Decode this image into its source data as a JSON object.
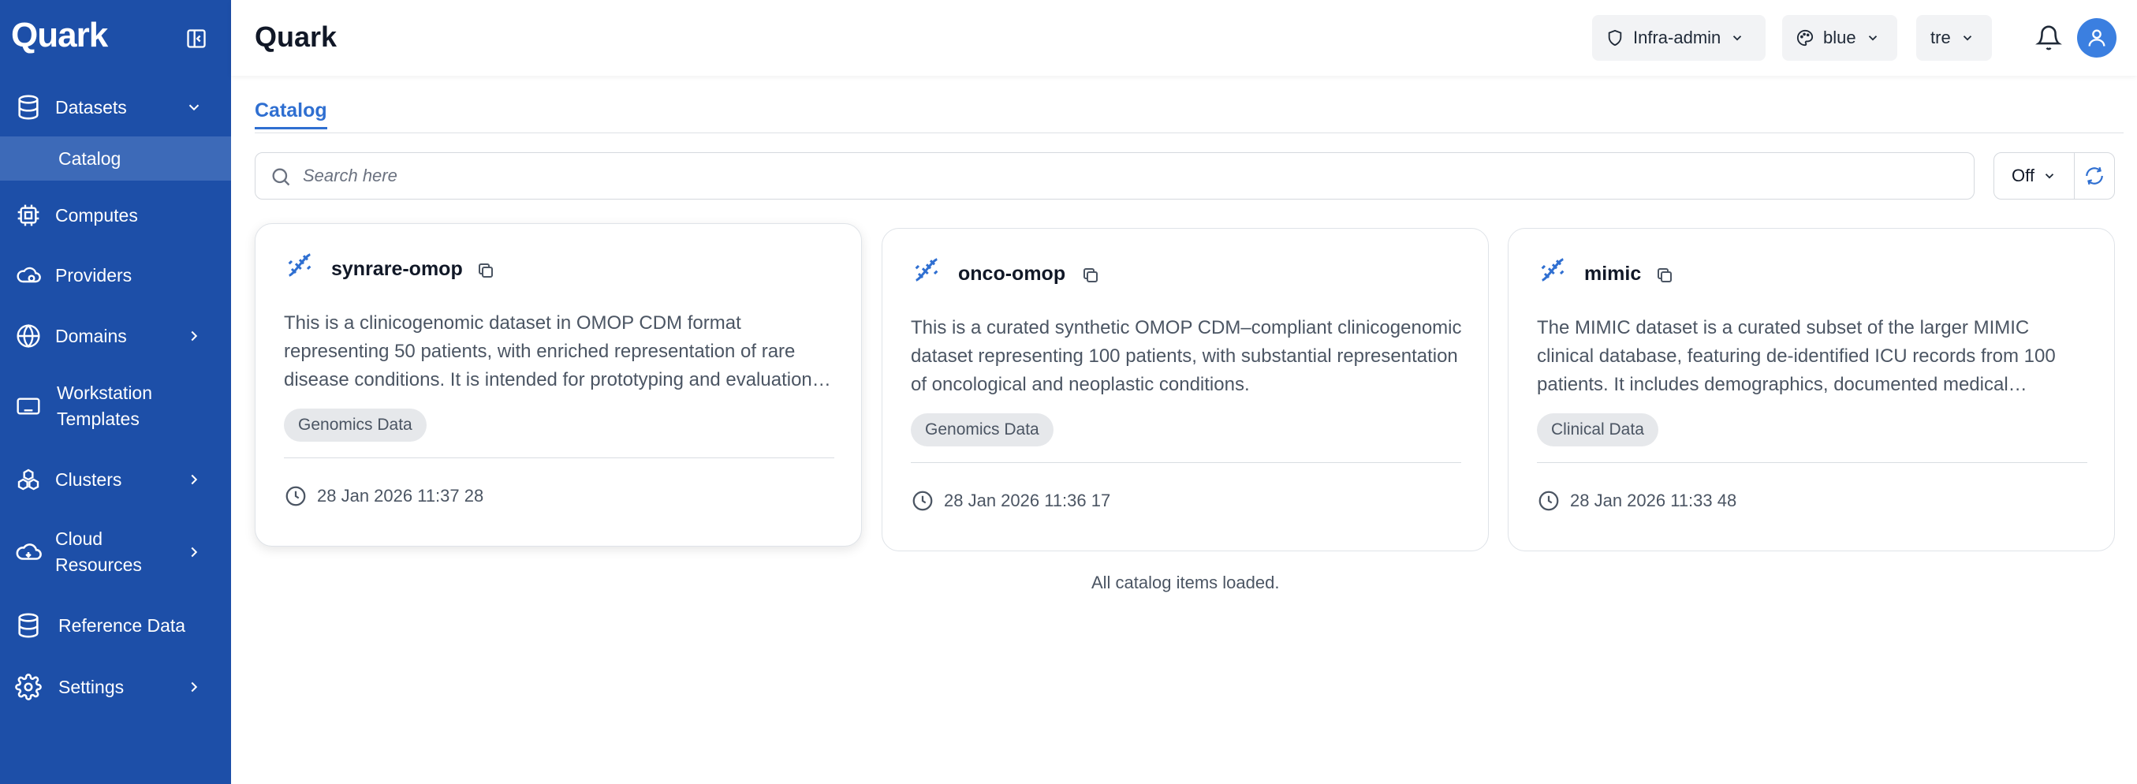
{
  "sidebar": {
    "brand": "Quark",
    "items": [
      {
        "label": "Datasets",
        "icon": "database-icon",
        "expanded": true
      },
      {
        "label": "Catalog",
        "active": true
      },
      {
        "label": "Computes",
        "icon": "cpu-icon"
      },
      {
        "label": "Providers",
        "icon": "provider-icon"
      },
      {
        "label": "Domains",
        "icon": "globe-icon"
      },
      {
        "label": "Workstation Templates",
        "icon": "keyboard-icon"
      },
      {
        "label": "Clusters",
        "icon": "clusters-icon"
      },
      {
        "label": "Cloud Resources",
        "icon": "cloud-icon"
      },
      {
        "label": "Reference Data",
        "icon": "database-icon"
      },
      {
        "label": "Settings",
        "icon": "gear-icon"
      }
    ]
  },
  "header": {
    "title": "Quark",
    "role": "Infra-admin",
    "theme": "blue",
    "tenant": "tre"
  },
  "tabs": [
    {
      "label": "Catalog",
      "active": true
    }
  ],
  "search": {
    "placeholder": "Search here",
    "value": ""
  },
  "filter": {
    "value": "Off"
  },
  "cards": [
    {
      "title": "synrare-omop",
      "description": "This is a clinicogenomic dataset in OMOP CDM format representing 50 patients, with enriched representation of rare disease conditions. It is intended for prototyping and evaluation of analytic methods.",
      "tag": "Genomics Data",
      "date": "28 Jan 2026 11:37 28"
    },
    {
      "title": "onco-omop",
      "description": "This is a curated synthetic OMOP CDM–compliant clinicogenomic dataset representing 100 patients, with substantial representation of oncological and neoplastic conditions.",
      "tag": "Genomics Data",
      "date": "28 Jan 2026 11:36 17"
    },
    {
      "title": "mimic",
      "description": "The MIMIC dataset is a curated subset of the larger MIMIC clinical database, featuring de-identified ICU records from 100 patients. It includes demographics, documented medical conditions and more.",
      "tag": "Clinical Data",
      "date": "28 Jan 2026 11:33 48"
    }
  ],
  "status": "All catalog items loaded.",
  "colors": {
    "sidebar": "#1d4fa8",
    "accent": "#2f6fd1",
    "avatar": "#3b7fe0"
  }
}
